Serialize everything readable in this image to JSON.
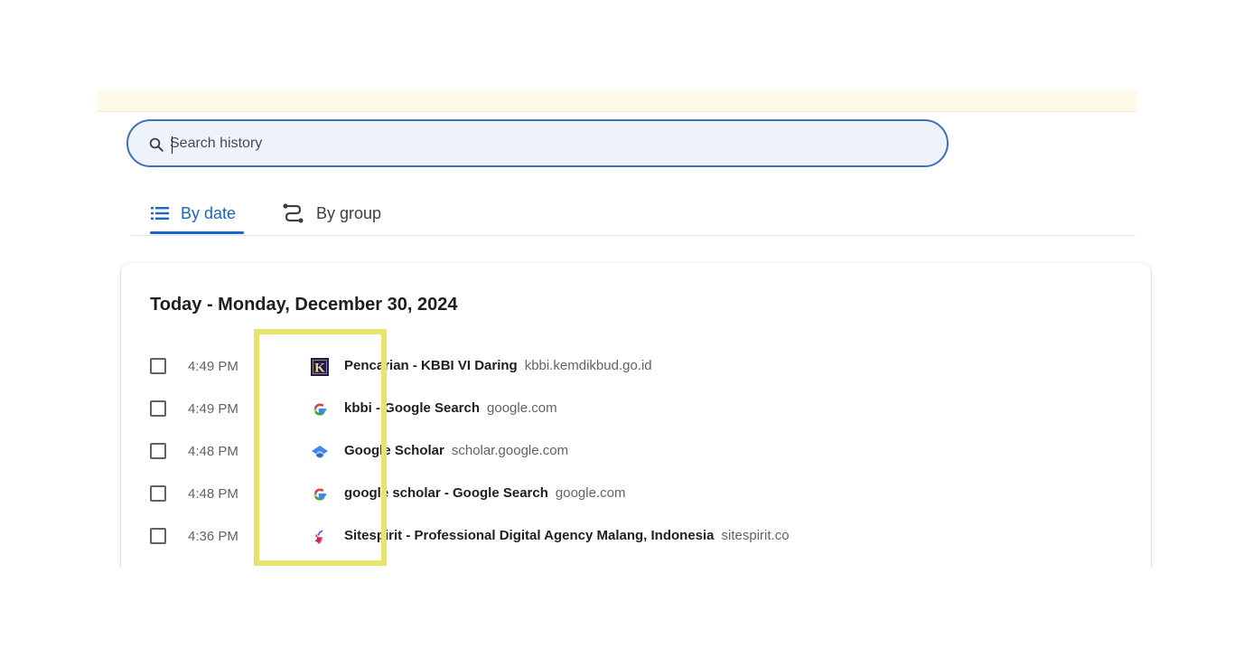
{
  "search": {
    "placeholder": "Search history"
  },
  "tabs": [
    {
      "label": "By date",
      "icon": "list-icon",
      "selected": true
    },
    {
      "label": "By group",
      "icon": "route-icon",
      "selected": false
    }
  ],
  "history": {
    "date_heading": "Today - Monday, December 30, 2024",
    "items": [
      {
        "time": "4:49 PM",
        "title": "Pencarian - KBBI VI Daring",
        "domain": "kbbi.kemdikbud.go.id",
        "favicon": "kbbi-favicon"
      },
      {
        "time": "4:49 PM",
        "title": "kbbi - Google Search",
        "domain": "google.com",
        "favicon": "google-favicon"
      },
      {
        "time": "4:48 PM",
        "title": "Google Scholar",
        "domain": "scholar.google.com",
        "favicon": "google-scholar-favicon"
      },
      {
        "time": "4:48 PM",
        "title": "google scholar - Google Search",
        "domain": "google.com",
        "favicon": "google-favicon"
      },
      {
        "time": "4:36 PM",
        "title": "Sitespirit - Professional Digital Agency Malang, Indonesia",
        "domain": "sitespirit.co",
        "favicon": "sitespirit-favicon"
      }
    ]
  },
  "colors": {
    "accent": "#1a66c7",
    "search_border": "#3f6fb8",
    "search_bg": "#eef2fa",
    "notice_bg": "#fff9ea",
    "highlight": "#e6e46a"
  }
}
